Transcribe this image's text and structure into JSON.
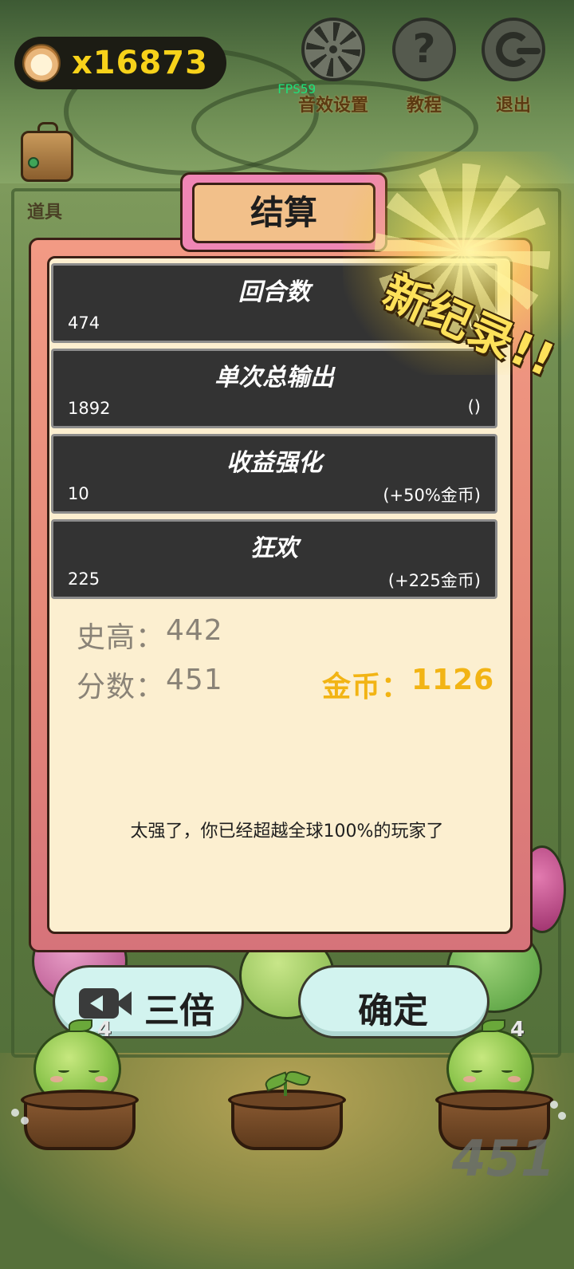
{
  "hud": {
    "coins": "x16873",
    "fps": "FPS59",
    "sound_settings_label": "音效设置",
    "tutorial_label": "教程",
    "exit_label": "退出",
    "tools_label": "道具"
  },
  "dialog": {
    "title": "结算",
    "new_record": "新纪录!!",
    "stats": [
      {
        "title": "回合数",
        "value": "474",
        "bonus": "()"
      },
      {
        "title": "单次总输出",
        "value": "1892",
        "bonus": "()"
      },
      {
        "title": "收益强化",
        "value": "10",
        "bonus": "(+50%金币)"
      },
      {
        "title": "狂欢",
        "value": "225",
        "bonus": "(+225金币)"
      }
    ],
    "best_label": "史高：",
    "best_value": "442",
    "score_label": "分数：",
    "score_value": "451",
    "coins_label": "金币：",
    "coins_value": "1126",
    "rank_message": "太强了，你已经超越全球100%的玩家了"
  },
  "buttons": {
    "triple_label": "三倍",
    "confirm_label": "确定"
  },
  "scene": {
    "plant_levels": [
      "4",
      "4"
    ],
    "score_watermark": "451"
  },
  "colors": {
    "coin_gold": "#f7d21a",
    "reward_gold": "#f2b414",
    "fps_green": "#1fe07a",
    "dialog_frame": "#e58878",
    "dialog_body": "#fcefd0",
    "stat_row": "#333333",
    "button_fill": "#d2f3ef"
  },
  "icons": {
    "coin": "coin-icon",
    "settings": "gear-icon",
    "tutorial": "question-icon",
    "exit": "exit-icon",
    "tools": "chest-icon",
    "video": "video-camera-icon"
  }
}
